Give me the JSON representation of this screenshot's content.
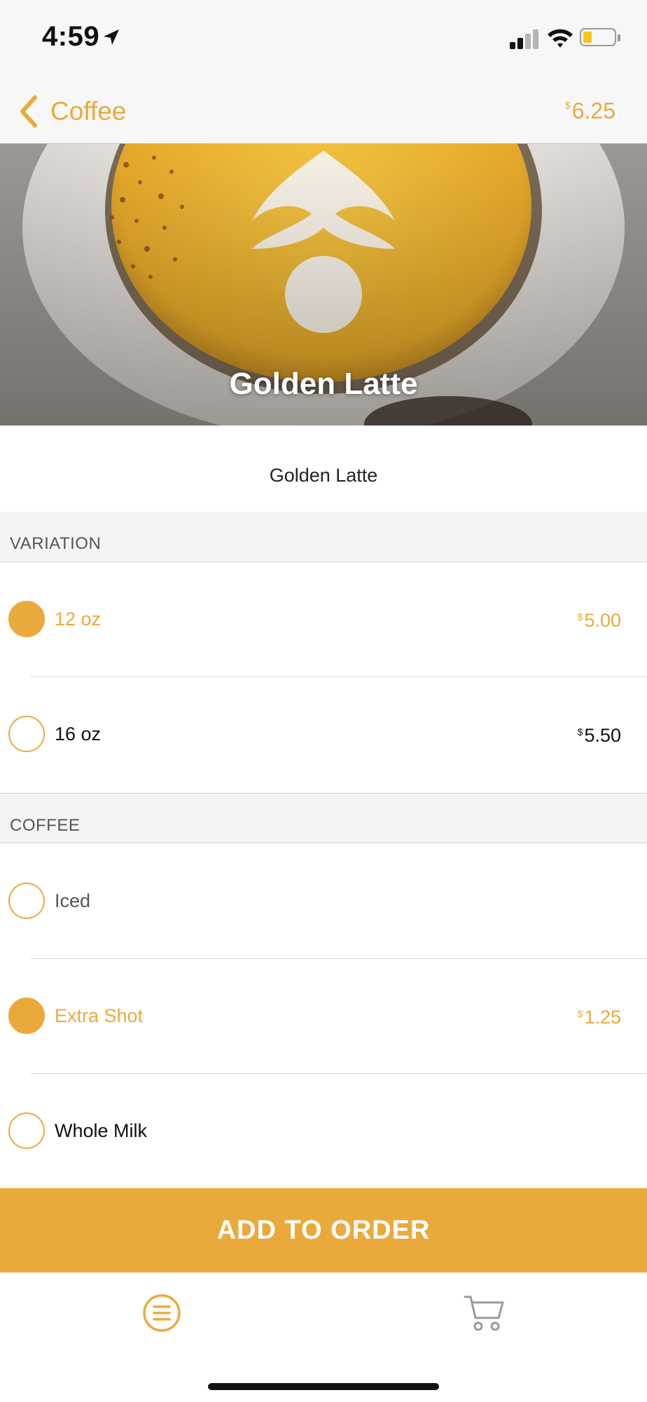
{
  "status_bar": {
    "time": "4:59",
    "battery_color": "#f5c518"
  },
  "nav": {
    "back_label": "Coffee",
    "total_currency": "$",
    "total_amount": "6.25",
    "back_icon": "chevron-left-icon"
  },
  "hero": {
    "title": "Golden Latte",
    "image": "golden-latte-photo"
  },
  "item": {
    "description": "Golden Latte"
  },
  "sections": [
    {
      "header": "VARIATION",
      "options": [
        {
          "label": "12 oz",
          "currency": "$",
          "price": "5.00",
          "selected": true
        },
        {
          "label": "16 oz",
          "currency": "$",
          "price": "5.50",
          "selected": false
        }
      ]
    },
    {
      "header": "COFFEE",
      "options": [
        {
          "label": "Iced",
          "currency": "",
          "price": "",
          "selected": false
        },
        {
          "label": "Extra Shot",
          "currency": "$",
          "price": "1.25",
          "selected": true
        },
        {
          "label": "Whole Milk",
          "currency": "",
          "price": "",
          "selected": false
        }
      ]
    }
  ],
  "add_button": {
    "label": "ADD TO ORDER"
  },
  "tab_bar": {
    "menu_icon": "menu-list-icon",
    "cart_icon": "cart-icon"
  },
  "colors": {
    "accent": "#eaaa3b",
    "background": "#ffffff",
    "section_bg": "#f4f4f4"
  }
}
